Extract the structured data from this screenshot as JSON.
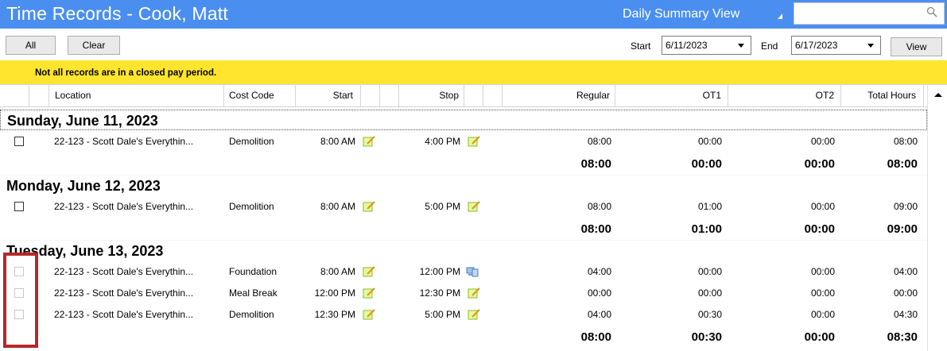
{
  "title": "Time Records - Cook, Matt",
  "view_label": "Daily Summary View",
  "search": {
    "value": ""
  },
  "toolbar": {
    "all_label": "All",
    "clear_label": "Clear",
    "start_label": "Start",
    "start_value": "6/11/2023",
    "end_label": "End",
    "end_value": "6/17/2023",
    "view_label": "View"
  },
  "warning": "Not all records are in a closed pay period.",
  "columns": {
    "location": "Location",
    "cost_code": "Cost Code",
    "start": "Start",
    "stop": "Stop",
    "regular": "Regular",
    "ot1": "OT1",
    "ot2": "OT2",
    "total": "Total Hours"
  },
  "days": [
    {
      "header": "Sunday, June 11, 2023",
      "records": [
        {
          "location": "22-123 - Scott Dale's Everythin...",
          "cost_code": "Demolition",
          "start": "8:00 AM",
          "start_icon": "note-icon",
          "stop": "4:00 PM",
          "stop_icon": "note-icon",
          "regular": "08:00",
          "ot1": "00:00",
          "ot2": "00:00",
          "total": "08:00"
        }
      ],
      "totals": {
        "regular": "08:00",
        "ot1": "00:00",
        "ot2": "00:00",
        "total": "08:00"
      }
    },
    {
      "header": "Monday, June 12, 2023",
      "records": [
        {
          "location": "22-123 - Scott Dale's Everythin...",
          "cost_code": "Demolition",
          "start": "8:00 AM",
          "start_icon": "note-icon",
          "stop": "5:00 PM",
          "stop_icon": "note-icon",
          "regular": "08:00",
          "ot1": "01:00",
          "ot2": "00:00",
          "total": "09:00"
        }
      ],
      "totals": {
        "regular": "08:00",
        "ot1": "01:00",
        "ot2": "00:00",
        "total": "09:00"
      }
    },
    {
      "header": "Tuesday, June 13, 2023",
      "records": [
        {
          "location": "22-123 - Scott Dale's Everythin...",
          "cost_code": "Foundation",
          "start": "8:00 AM",
          "start_icon": "note-icon",
          "stop": "12:00 PM",
          "stop_icon": "computer-icon",
          "regular": "04:00",
          "ot1": "00:00",
          "ot2": "00:00",
          "total": "04:00"
        },
        {
          "location": "22-123 - Scott Dale's Everythin...",
          "cost_code": "Meal Break",
          "start": "12:00 PM",
          "start_icon": "note-icon",
          "stop": "12:30 PM",
          "stop_icon": "note-icon",
          "regular": "00:00",
          "ot1": "00:00",
          "ot2": "00:00",
          "total": "00:00"
        },
        {
          "location": "22-123 - Scott Dale's Everythin...",
          "cost_code": "Demolition",
          "start": "12:30 PM",
          "start_icon": "note-icon",
          "stop": "5:00 PM",
          "stop_icon": "note-icon",
          "regular": "04:00",
          "ot1": "00:30",
          "ot2": "00:00",
          "total": "04:30"
        }
      ],
      "totals": {
        "regular": "08:00",
        "ot1": "00:30",
        "ot2": "00:00",
        "total": "08:30"
      }
    }
  ],
  "colors": {
    "titlebar": "#4a8ff0",
    "warning": "#ffe52e",
    "highlight": "#b6282a"
  }
}
